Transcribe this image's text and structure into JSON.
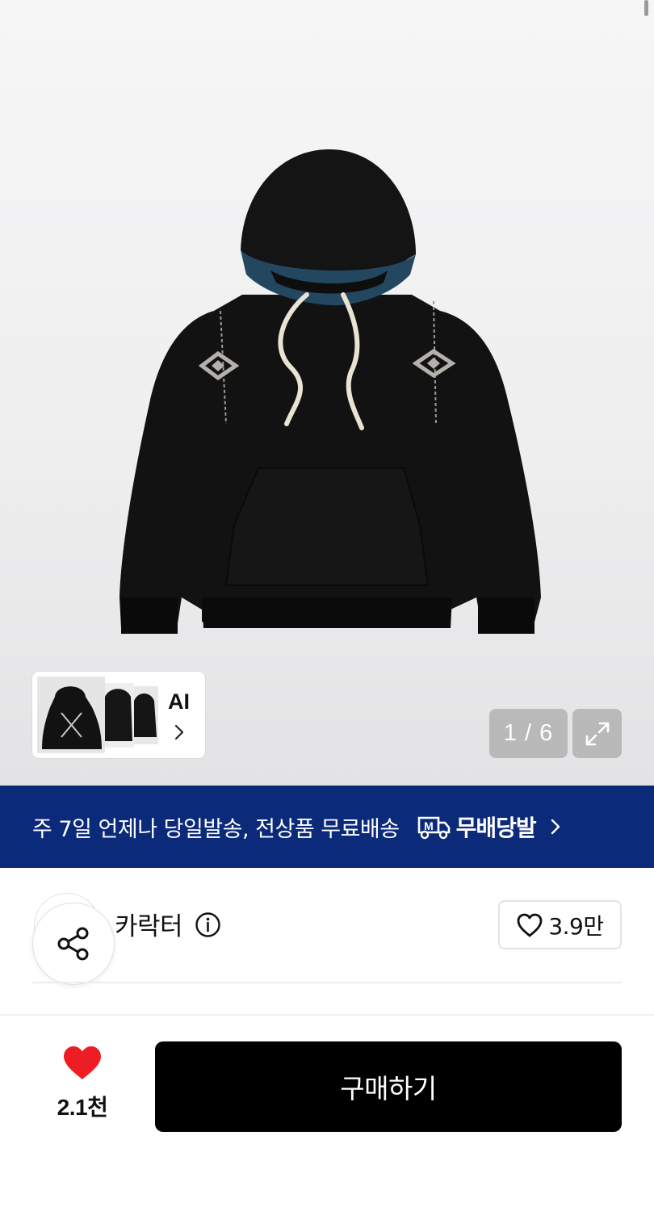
{
  "gallery": {
    "current_page": 1,
    "total_pages": 6,
    "counter_text": "1 / 6",
    "ai_label": "AI",
    "icons": {
      "expand": "expand-arrows-icon",
      "chevron": "chevron-right-icon"
    }
  },
  "banner": {
    "text": "주 7일 언제나 당일발송, 전상품 무료배송",
    "logo_badge": "M",
    "logo_text": "무배당발",
    "background_color": "#0c2a7a"
  },
  "brand": {
    "name": "카락터",
    "like_count": "3.9만",
    "icons": {
      "info": "info-icon",
      "heart": "heart-outline-icon",
      "share": "share-icon"
    }
  },
  "bottom_bar": {
    "wish_count": "2.1천",
    "wish_color": "#ee1c24",
    "buy_label": "구매하기"
  }
}
